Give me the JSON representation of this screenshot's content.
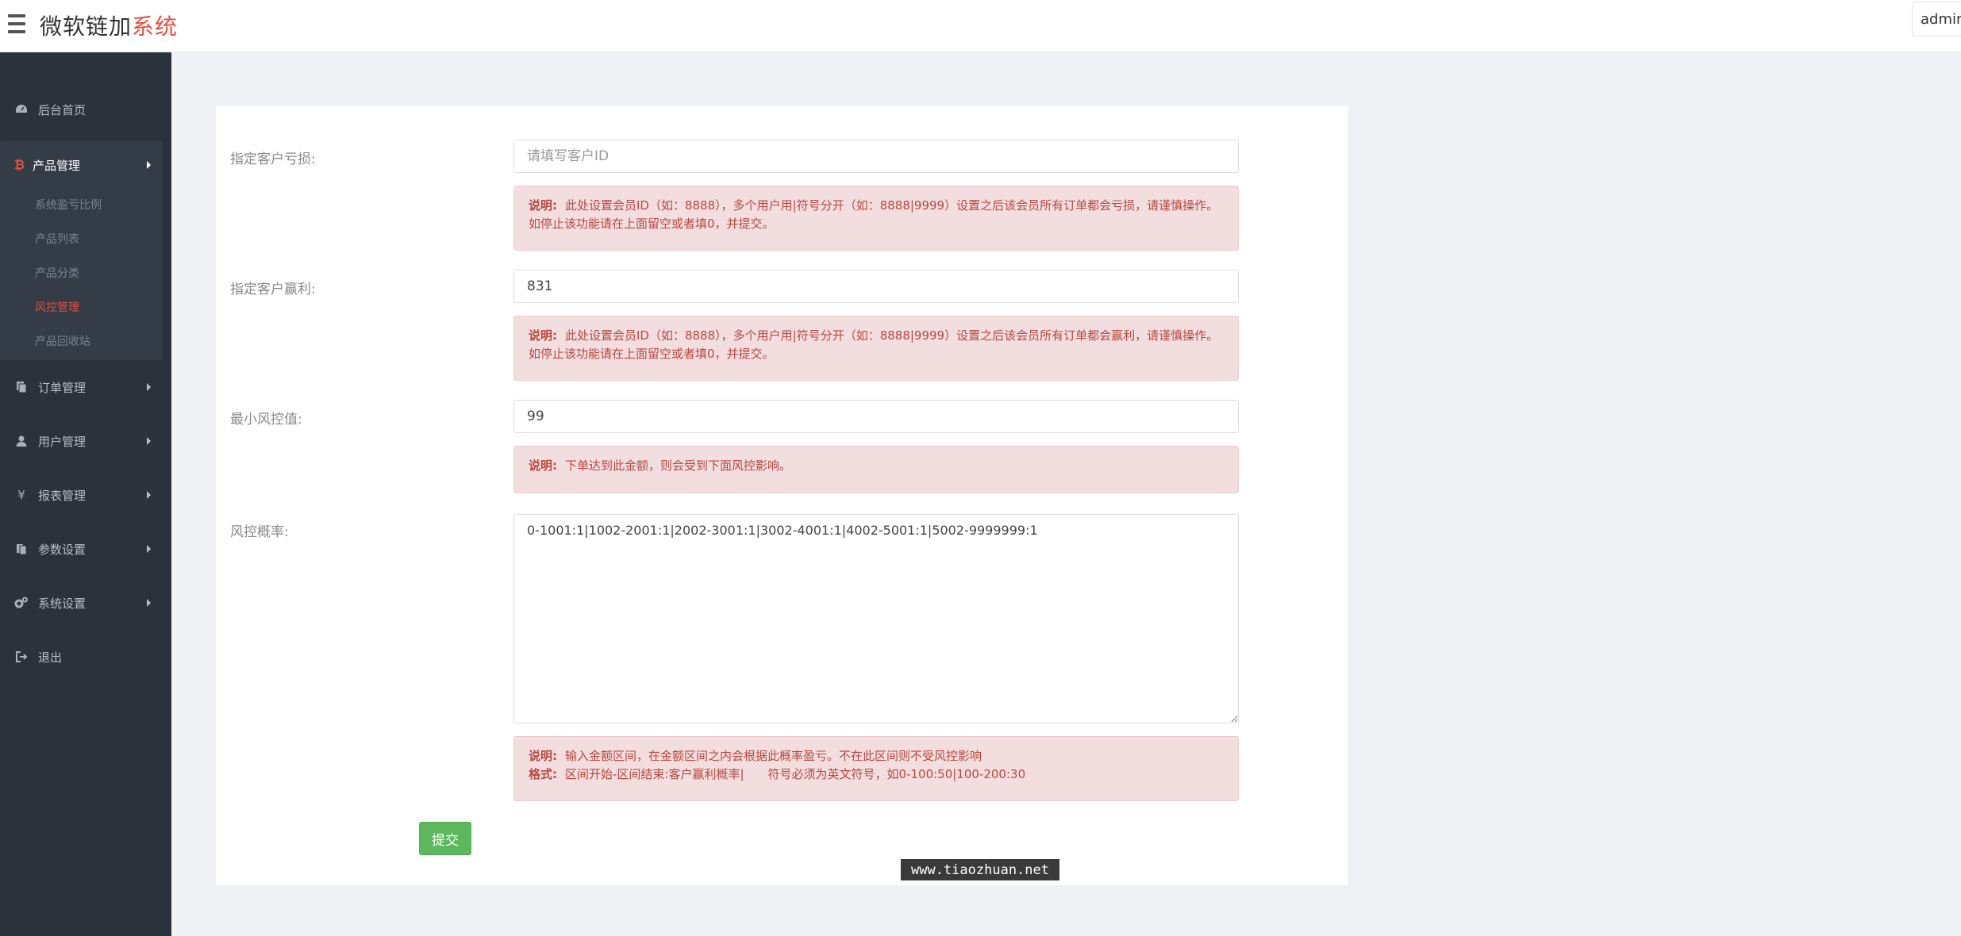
{
  "header": {
    "brand_main": "微软链加",
    "brand_accent": "系统",
    "user": "admin"
  },
  "sidebar": {
    "dashboard": "后台首页",
    "product_group": {
      "label": "产品管理",
      "items": [
        "系统盈亏比例",
        "产品列表",
        "产品分类",
        "风控管理",
        "产品回收站"
      ],
      "active_index": 3
    },
    "orders": "订单管理",
    "users": "用户管理",
    "reports": "报表管理",
    "params": "参数设置",
    "system": "系统设置",
    "logout": "退出"
  },
  "form": {
    "loss": {
      "label": "指定客户亏损:",
      "value": "",
      "placeholder": "请填写客户ID",
      "note_title": "说明:",
      "note_text": "此处设置会员ID（如：8888），多个用户用|符号分开（如：8888|9999）设置之后该会员所有订单都会亏损，请谨慎操作。如停止该功能请在上面留空或者填0，并提交。"
    },
    "profit": {
      "label": "指定客户赢利:",
      "value": "831",
      "note_title": "说明:",
      "note_text": "此处设置会员ID（如：8888），多个用户用|符号分开（如：8888|9999）设置之后该会员所有订单都会赢利，请谨慎操作。如停止该功能请在上面留空或者填0，并提交。"
    },
    "min_risk": {
      "label": "最小风控值:",
      "value": "99",
      "note_title": "说明:",
      "note_text": "下单达到此金额，则会受到下面风控影响。"
    },
    "risk_rate": {
      "label": "风控概率:",
      "value": "0-1001:1|1002-2001:1|2002-3001:1|3002-4001:1|4002-5001:1|5002-9999999:1",
      "note_title": "说明:",
      "note_text": "输入金额区间，在金额区间之内会根据此概率盈亏。不在此区间则不受风控影响",
      "format_title": "格式:",
      "format_text": "区间开始-区间结束:客户赢利概率|　　符号必须为英文符号，如0-100:50|100-200:30"
    },
    "submit_label": "提交"
  },
  "watermark": "www.tiaozhuan.net",
  "colors": {
    "sidebar_bg": "#2b323c",
    "accent_red": "#e74c3c",
    "submit_green": "#5cb85c",
    "note_bg": "#f2dede"
  }
}
